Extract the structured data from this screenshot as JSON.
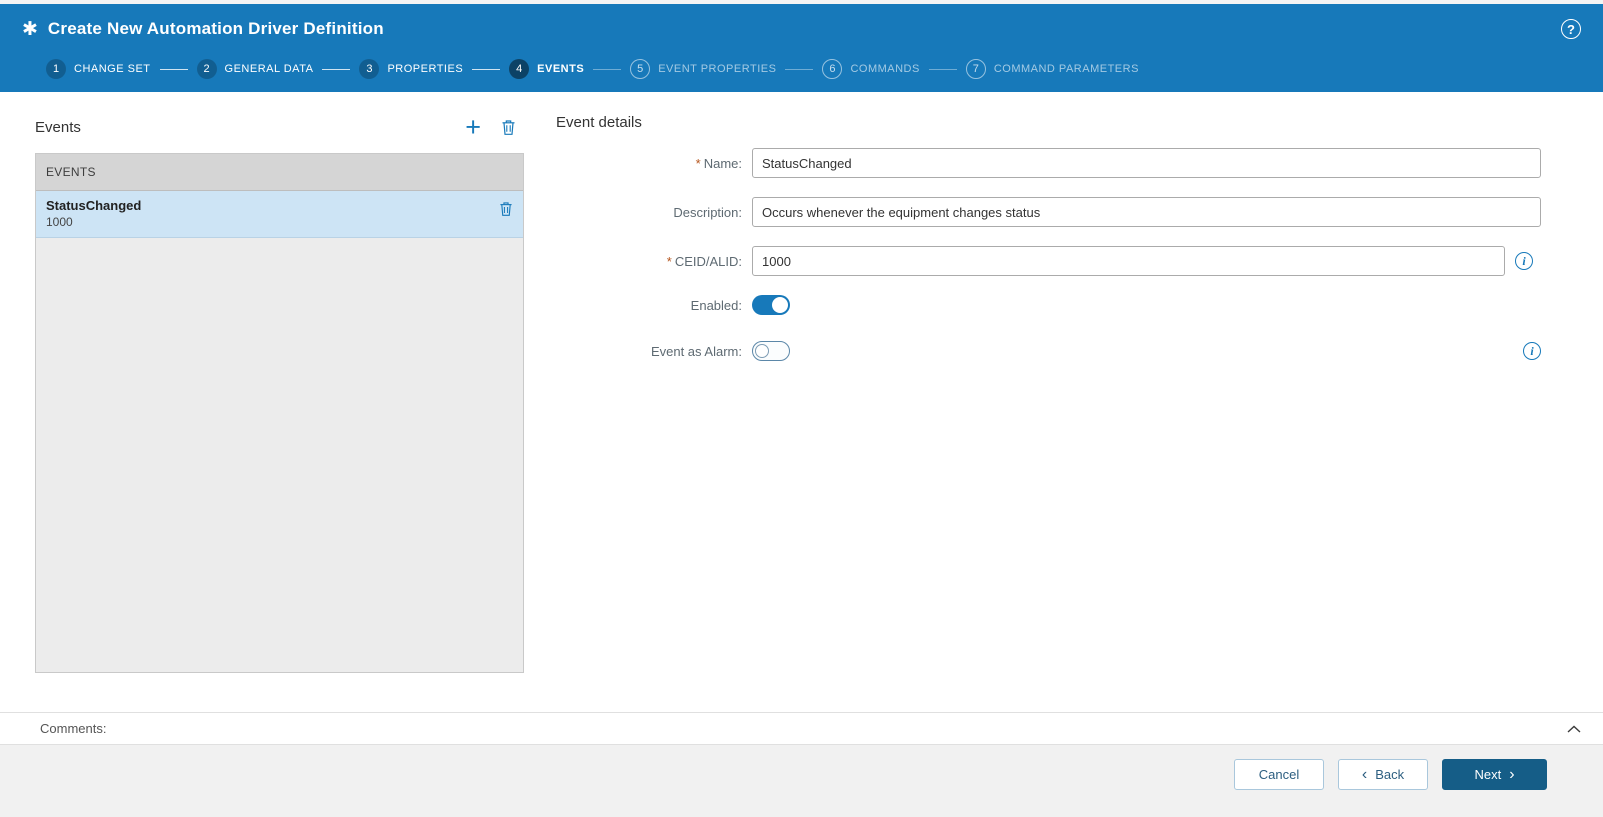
{
  "header": {
    "title": "Create New Automation Driver Definition"
  },
  "stepper": {
    "steps": [
      {
        "number": "1",
        "label": "CHANGE SET",
        "state": "done"
      },
      {
        "number": "2",
        "label": "GENERAL DATA",
        "state": "done"
      },
      {
        "number": "3",
        "label": "PROPERTIES",
        "state": "done"
      },
      {
        "number": "4",
        "label": "EVENTS",
        "state": "active"
      },
      {
        "number": "5",
        "label": "EVENT PROPERTIES",
        "state": "todo"
      },
      {
        "number": "6",
        "label": "COMMANDS",
        "state": "todo"
      },
      {
        "number": "7",
        "label": "COMMAND PARAMETERS",
        "state": "todo"
      }
    ]
  },
  "events_panel": {
    "title": "Events",
    "table_header": "EVENTS",
    "items": [
      {
        "name": "StatusChanged",
        "id": "1000",
        "selected": true
      }
    ]
  },
  "details_panel": {
    "title": "Event details",
    "fields": {
      "name": {
        "label": "Name:",
        "required": true,
        "value": "StatusChanged"
      },
      "description": {
        "label": "Description:",
        "required": false,
        "value": "Occurs whenever the equipment changes status"
      },
      "ceid": {
        "label": "CEID/ALID:",
        "required": true,
        "value": "1000"
      },
      "enabled": {
        "label": "Enabled:",
        "value": true
      },
      "event_as_alarm": {
        "label": "Event as Alarm:",
        "value": false
      }
    },
    "required_mark": "*"
  },
  "comments": {
    "label": "Comments:"
  },
  "footer": {
    "cancel_label": "Cancel",
    "back_label": "Back",
    "next_label": "Next"
  },
  "icons": {
    "title": "✱",
    "help": "?",
    "add": "+",
    "info": "i",
    "back_chevron": "‹",
    "next_chevron": "›"
  },
  "colors": {
    "header_blue": "#1779ba",
    "primary_button": "#155d87",
    "selected_row": "#cde4f5",
    "required_mark": "#b5541b"
  }
}
